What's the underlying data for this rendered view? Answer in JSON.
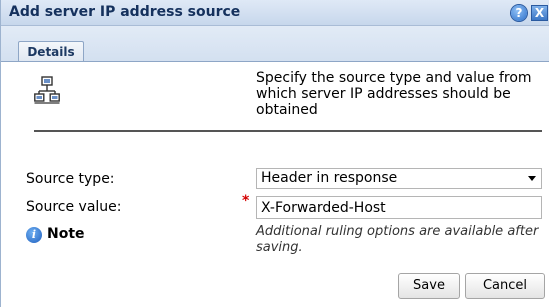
{
  "dialog": {
    "title": "Add server IP address source",
    "help_glyph": "?",
    "close_glyph": "X"
  },
  "tabs": [
    {
      "label": "Details",
      "active": true
    }
  ],
  "details": {
    "icon": "network-icon",
    "description": "Specify the source type and value from which server IP addresses should be obtained",
    "source_type": {
      "label": "Source type:",
      "value": "Header in response"
    },
    "source_value": {
      "label": "Source value:",
      "required_marker": "*",
      "value": "X-Forwarded-Host"
    },
    "note": {
      "icon": "info-icon",
      "icon_glyph": "i",
      "label": "Note",
      "text": "Additional ruling options are available after saving."
    }
  },
  "buttons": {
    "save_label": "Save",
    "cancel_label": "Cancel"
  },
  "colors": {
    "title_text": "#15315d",
    "titlebar_bg": "#c7d7ec",
    "required": "#d40000"
  }
}
